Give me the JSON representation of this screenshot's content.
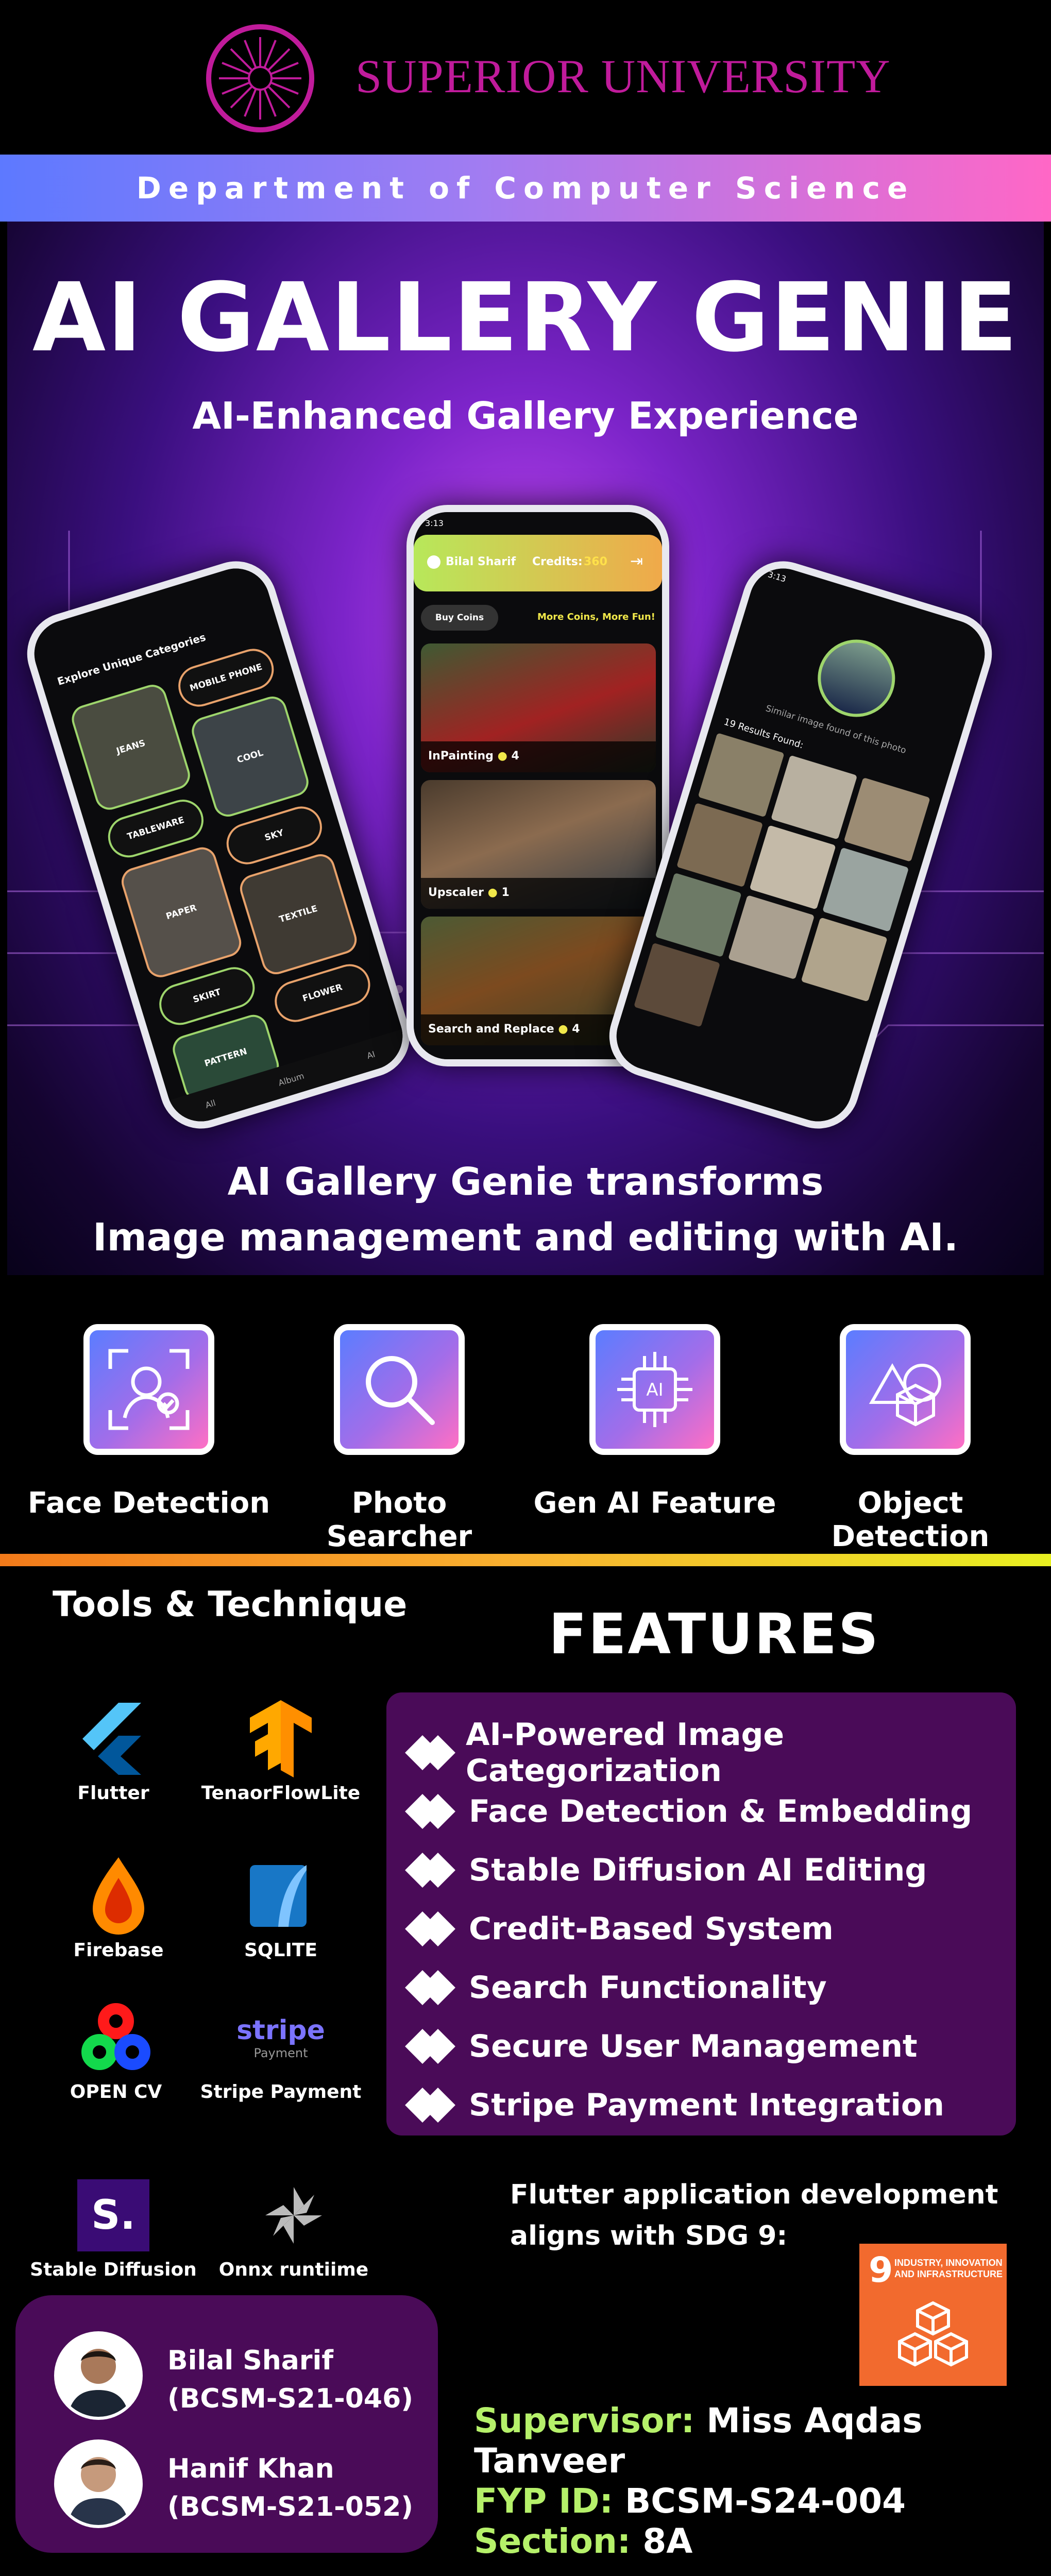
{
  "header": {
    "university": "SUPERIOR UNIVERSITY",
    "department": "Department of Computer Science"
  },
  "hero": {
    "title": "AI GALLERY GENIE",
    "subtitle": "AI-Enhanced Gallery Experience",
    "tagline_line1": "AI Gallery Genie transforms",
    "tagline_line2": "Image management and editing with AI."
  },
  "phone_left": {
    "header": "Explore Unique Categories",
    "categories": [
      "JEANS",
      "MOBILE PHONE",
      "COOL",
      "TABLEWARE",
      "SKY",
      "PAPER",
      "TEXTILE",
      "SKIRT",
      "FLOWER",
      "PATTERN"
    ],
    "tabs": [
      "All",
      "Album",
      "AI"
    ]
  },
  "phone_center": {
    "status_time": "3:13",
    "user": "Bilal Sharif",
    "credits_label": "Credits:",
    "credits": "360",
    "buy_coins": "Buy Coins",
    "promo": "More Coins, More Fun!",
    "cards": [
      {
        "label": "InPainting",
        "cost": "4"
      },
      {
        "label": "Upscaler",
        "cost": "1"
      },
      {
        "label": "Search and Replace",
        "cost": "4"
      }
    ]
  },
  "phone_right": {
    "status_time": "3:13",
    "caption": "Similar image found of this photo",
    "results": "19 Results Found:"
  },
  "feature_icons": [
    {
      "label": "Face Detection",
      "icon": "face-scan-icon"
    },
    {
      "label": "Photo Searcher",
      "icon": "magnifier-icon"
    },
    {
      "label": "Gen AI Feature",
      "icon": "ai-chip-icon",
      "chip_text": "AI"
    },
    {
      "label": "Object Detection",
      "icon": "shapes-icon"
    }
  ],
  "tools": {
    "title": "Tools & Technique",
    "items": [
      {
        "label": "Flutter",
        "icon": "flutter-icon"
      },
      {
        "label": "TenaorFlowLite",
        "icon": "tensorflow-icon"
      },
      {
        "label": "Firebase",
        "icon": "firebase-icon"
      },
      {
        "label": "SQLITE",
        "icon": "sqlite-icon"
      },
      {
        "label": "OPEN CV",
        "icon": "opencv-icon"
      },
      {
        "label": "Stripe Payment",
        "icon": "stripe-icon",
        "logo_text": "stripe",
        "logo_sub": "Payment"
      },
      {
        "label": "Stable Diffusion",
        "icon": "stable-diffusion-icon",
        "logo_text": "S."
      },
      {
        "label": "Onnx runtiime",
        "icon": "onnx-icon"
      }
    ]
  },
  "features": {
    "title": "FEATURES",
    "items": [
      "AI-Powered Image Categorization",
      "Face Detection & Embedding",
      "Stable Diffusion AI Editing",
      "Credit-Based System",
      "Search Functionality",
      "Secure User Management",
      "Stripe Payment Integration"
    ]
  },
  "sdg": {
    "text_line1": "Flutter application development",
    "text_line2": "aligns with SDG 9:",
    "number": "9",
    "label": "INDUSTRY, INNOVATION AND INFRASTRUCTURE"
  },
  "team": [
    {
      "name": "Bilal Sharif",
      "id": "(BCSM-S21-046)"
    },
    {
      "name": "Hanif Khan",
      "id": "(BCSM-S21-052)"
    }
  ],
  "info": {
    "supervisor_key": "Supervisor:",
    "supervisor": "Miss Aqdas Tanveer",
    "fyp_key": "FYP ID:",
    "fyp": "BCSM-S24-004",
    "section_key": "Section:",
    "section": "8A"
  },
  "colors": {
    "brand": "#c01b9b",
    "accent_green": "#b5f06a",
    "panel": "#4a0b58",
    "sdg_orange": "#f26a2e"
  }
}
